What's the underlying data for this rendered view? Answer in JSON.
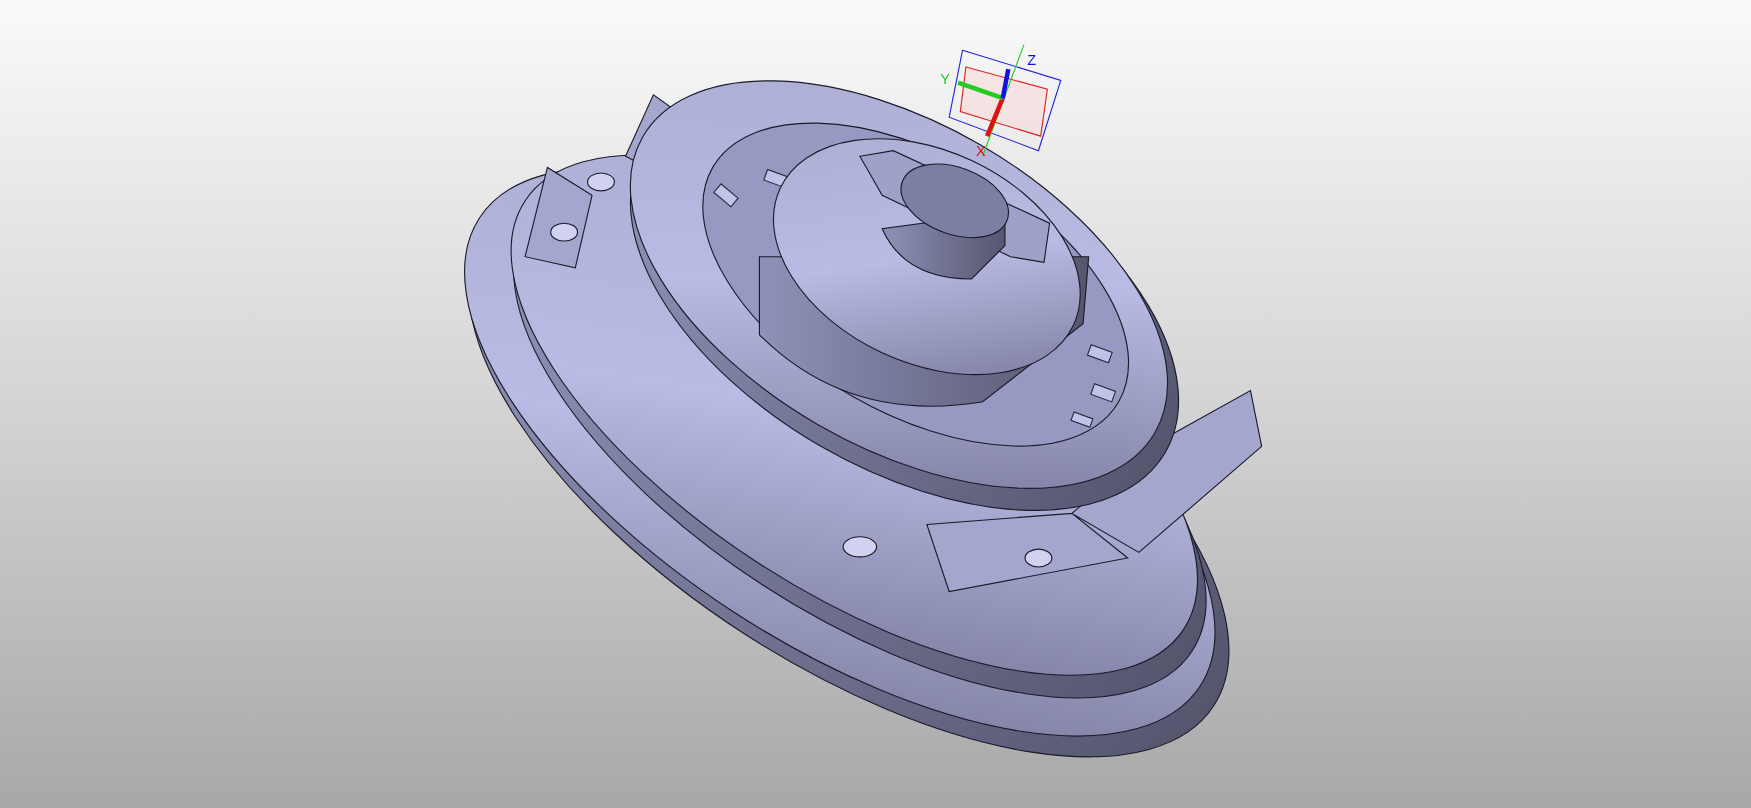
{
  "viewport": {
    "triad": [
      {
        "kind": "x",
        "label": "X"
      },
      {
        "kind": "y",
        "label": "Y"
      },
      {
        "kind": "z",
        "label": "Z"
      }
    ]
  }
}
